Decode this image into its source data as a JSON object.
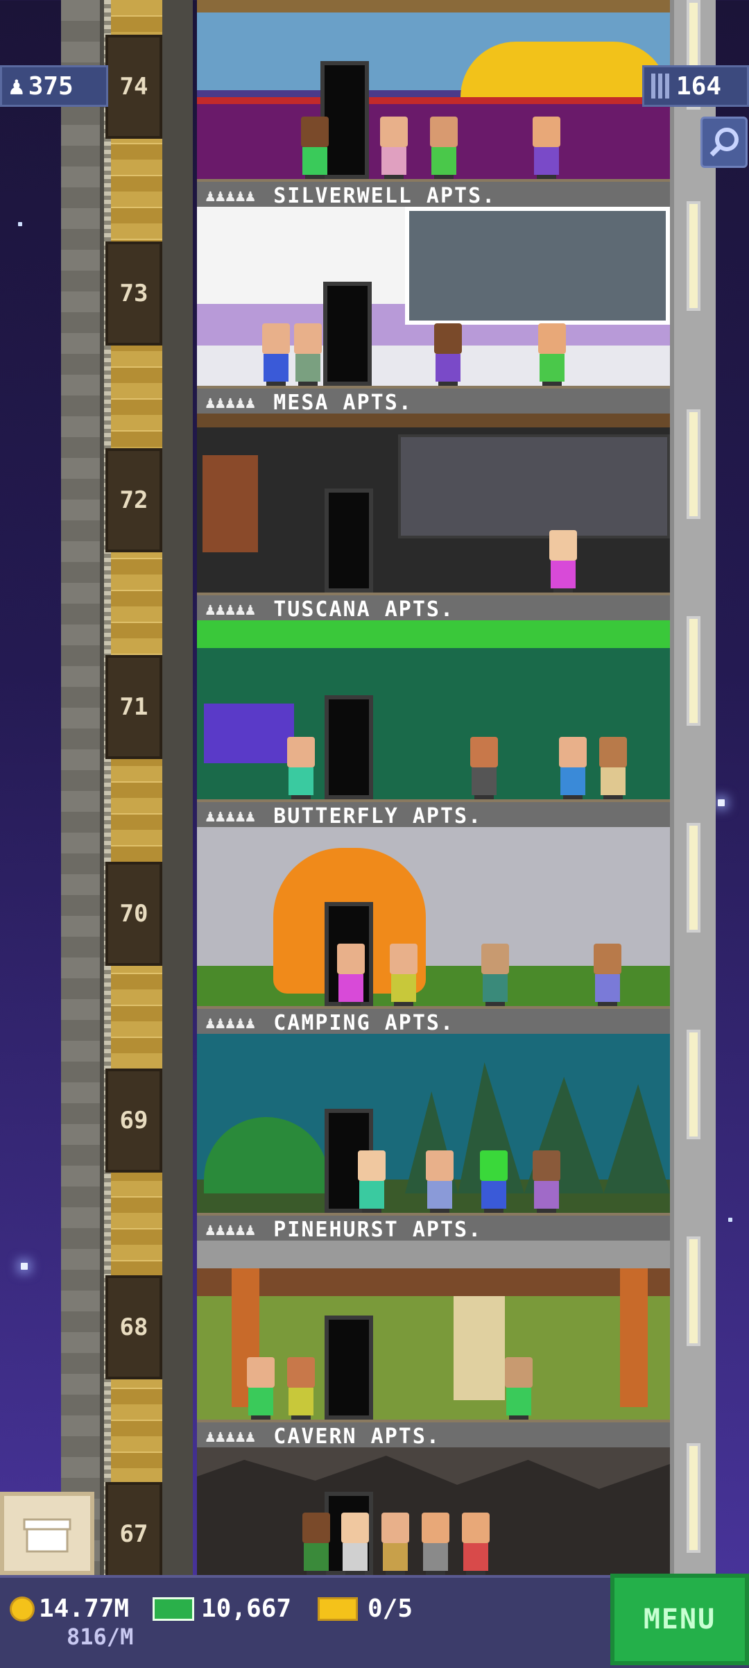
{
  "header": {
    "population": "375",
    "bitizens_label": "164",
    "population_icon": "person-icon",
    "floors_icon": "building-icon"
  },
  "floors": [
    {
      "number": "74",
      "name": "SILVERWELL APTS."
    },
    {
      "number": "73",
      "name": "MESA APTS."
    },
    {
      "number": "72",
      "name": "TUSCANA APTS."
    },
    {
      "number": "71",
      "name": "BUTTERFLY APTS."
    },
    {
      "number": "70",
      "name": "CAMPING APTS."
    },
    {
      "number": "69",
      "name": "PINEHURST APTS."
    },
    {
      "number": "68",
      "name": "CAVERN APTS."
    },
    {
      "number": "67",
      "name": ""
    }
  ],
  "resident_marks": "♟♟♟♟♟",
  "footer": {
    "coins": "14.77M",
    "coin_rate": "816/M",
    "bux": "10,667",
    "tickets": "0/5",
    "menu_label": "MENU"
  },
  "colors": {
    "menu_green": "#24b04a",
    "bottom_bar": "#3c3c6a",
    "badge": "#3c4a7e"
  }
}
